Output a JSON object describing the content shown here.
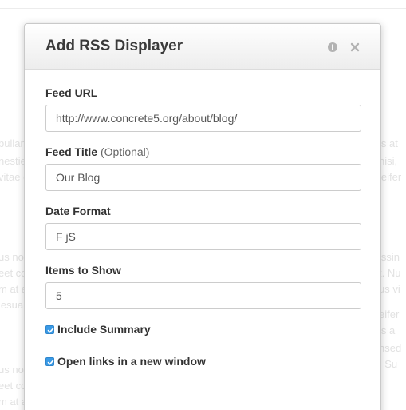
{
  "background": {
    "left_lines": [
      "bullan",
      "nestie",
      "vitae c",
      "",
      "",
      "us nor",
      "eet co",
      "m at a",
      "lesua",
      "",
      "",
      "us nor",
      "eet co",
      "m at a"
    ],
    "right_lines": [
      "is at",
      "nisi,",
      "leifer",
      "",
      "",
      "issin",
      "t. Nu",
      "us vi",
      "",
      "eifer",
      "is a",
      "nsed",
      ". Su",
      ""
    ]
  },
  "modal": {
    "title": "Add RSS Displayer",
    "icons": {
      "info": "info-icon",
      "close": "close-icon"
    },
    "fields": {
      "feed_url": {
        "label": "Feed URL",
        "value": "http://www.concrete5.org/about/blog/"
      },
      "feed_title": {
        "label": "Feed Title",
        "optional": "(Optional)",
        "value": "Our Blog"
      },
      "date_format": {
        "label": "Date Format",
        "value": "F jS"
      },
      "items_to_show": {
        "label": "Items to Show",
        "value": "5"
      }
    },
    "checkboxes": {
      "include_summary": {
        "label": "Include Summary",
        "checked": true
      },
      "open_new_window": {
        "label": "Open links in a new window",
        "checked": true
      }
    }
  },
  "colors": {
    "accent": "#3a9ae6"
  }
}
